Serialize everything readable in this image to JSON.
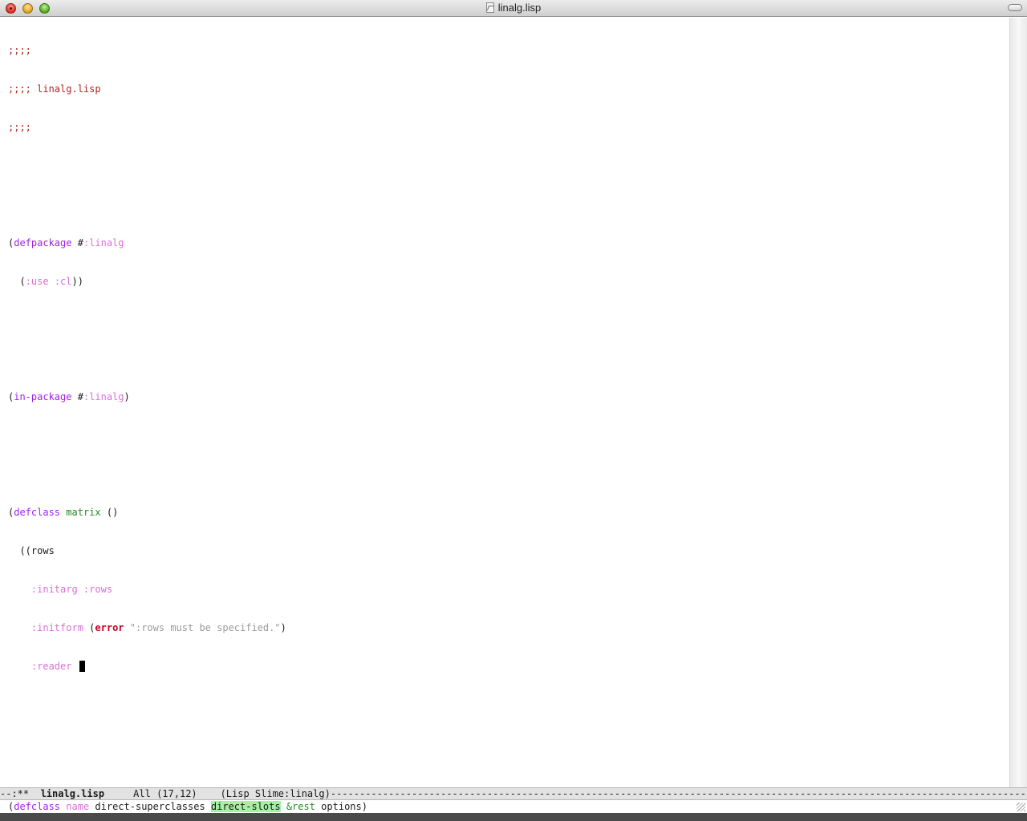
{
  "window": {
    "title": "linalg.lisp",
    "file_icon": "document-icon"
  },
  "editor": {
    "lines": {
      "l1": ";;;;",
      "l2": ";;;; linalg.lisp",
      "l3": ";;;;",
      "l6_paren": "(",
      "l6_kw": "defpackage",
      "l6_sp": " #",
      "l6_name": ":linalg",
      "l7_indent": "  (",
      "l7_use": ":use",
      "l7_sp": " ",
      "l7_cl": ":cl",
      "l7_close": "))",
      "l10_paren": "(",
      "l10_kw": "in-package",
      "l10_sp": " #",
      "l10_name": ":linalg",
      "l10_close": ")",
      "l13_paren": "(",
      "l13_kw": "defclass",
      "l13_sp": " ",
      "l13_name": "matrix",
      "l13_rest": " ()",
      "l14": "  ((rows",
      "l15_indent": "    ",
      "l15_key": ":initarg :rows",
      "l16_indent": "    ",
      "l16_key": ":initform",
      "l16_sp": " (",
      "l16_fn": "error",
      "l16_sp2": " ",
      "l16_str": "\":rows must be specified.\"",
      "l16_close": ")",
      "l17_indent": "    ",
      "l17_key": ":reader",
      "l17_sp": " "
    }
  },
  "modeline": {
    "status": "--:**  ",
    "buffer": "linalg.lisp",
    "position": "     All (17,12)    ",
    "mode": "(Lisp Slime:linalg)",
    "fill": "----------------------------------------------------------------------------------------------------------------------------------------------------------"
  },
  "echo": {
    "open": "(",
    "kw": "defclass",
    "sp1": " ",
    "arg_name": "name",
    "arg_super": " direct-superclasses ",
    "arg_slots": "direct-slots",
    "sp2": " ",
    "rest_kw": "&rest",
    "rest": " options)"
  },
  "colors": {
    "comment": "#b22222",
    "keyword": "#a020f0",
    "constant": "#da70d6",
    "type": "#228b22",
    "warning": "#c00020",
    "string": "#9a9a9a",
    "echo_highlight": "#a6f0a6"
  },
  "cursor": {
    "line": 17,
    "column": 12
  }
}
